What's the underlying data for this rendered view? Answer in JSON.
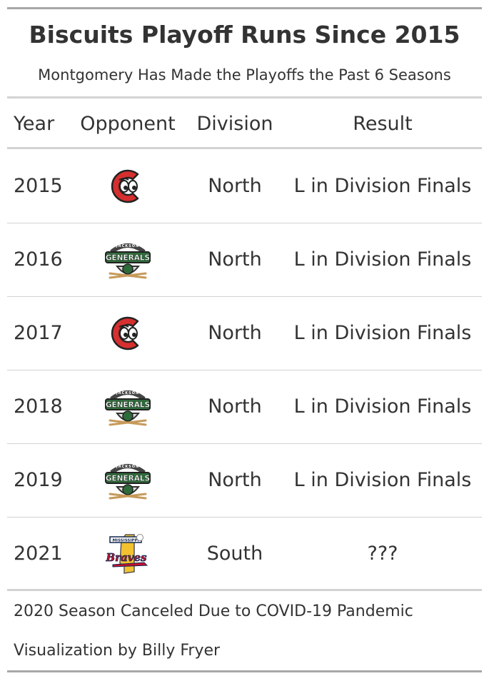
{
  "chart_data": {
    "type": "table",
    "title": "Biscuits Playoff Runs Since 2015",
    "subtitle": "Montgomery Has Made the Playoffs the Past 6 Seasons",
    "columns": [
      "Year",
      "Opponent",
      "Division",
      "Result"
    ],
    "rows": [
      {
        "year": "2015",
        "opponent_logo": "chattanooga-lookouts-logo-icon",
        "division": "North",
        "result": "L in Division Finals"
      },
      {
        "year": "2016",
        "opponent_logo": "jackson-generals-logo-icon",
        "division": "North",
        "result": "L in Division Finals"
      },
      {
        "year": "2017",
        "opponent_logo": "chattanooga-lookouts-logo-icon",
        "division": "North",
        "result": "L in Division Finals"
      },
      {
        "year": "2018",
        "opponent_logo": "jackson-generals-logo-icon",
        "division": "North",
        "result": "L in Division Finals"
      },
      {
        "year": "2019",
        "opponent_logo": "jackson-generals-logo-icon",
        "division": "North",
        "result": "L in Division Finals"
      },
      {
        "year": "2021",
        "opponent_logo": "mississippi-braves-logo-icon",
        "division": "South",
        "result": "???"
      }
    ],
    "footnotes": [
      "2020 Season Canceled Due to COVID-19 Pandemic",
      "Visualization by Billy Fryer"
    ]
  },
  "logos": {
    "generals_text": "GENERALS",
    "generals_arc": "JACKSON",
    "braves_banner": "MISSISSIPPI",
    "braves_script": "Braves"
  },
  "colors": {
    "text": "#333333",
    "rule_thick": "#d3d3d3",
    "frame_rule": "#a8a8a8",
    "lookouts_red": "#d62f2f",
    "generals_green": "#2e6b3a",
    "braves_red": "#c8102e",
    "braves_navy": "#13274f",
    "braves_gold": "#f2c230"
  }
}
